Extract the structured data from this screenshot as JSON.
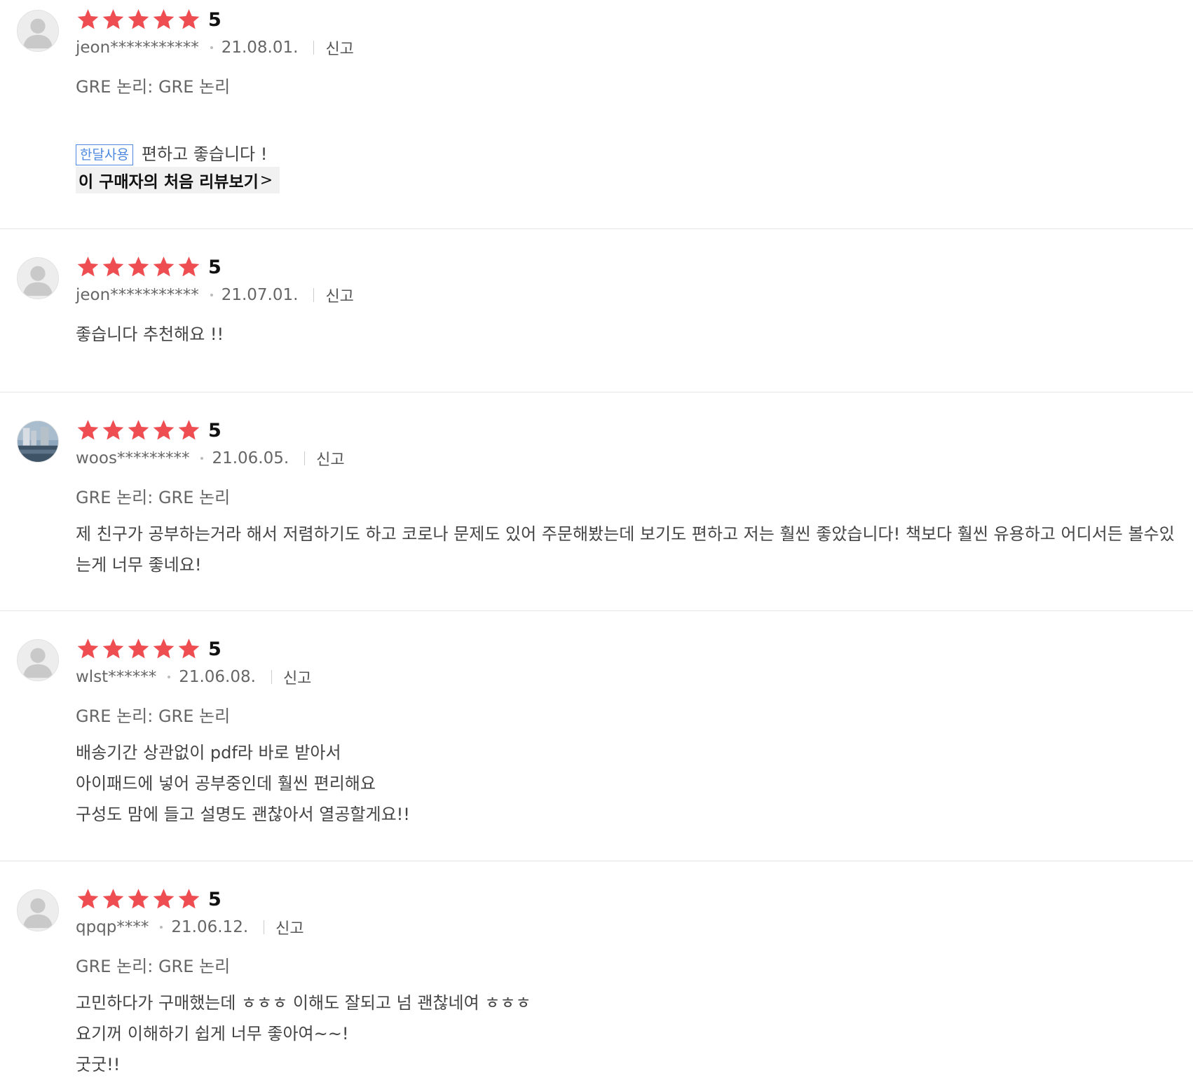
{
  "colors": {
    "star": "#ee4e52",
    "badge": "#4f8ae0",
    "divider": "#e5e5e5"
  },
  "reviews": [
    {
      "avatar": "default-avatar-icon",
      "score": "5",
      "stars": 5,
      "user": "jeon***********",
      "date": "21.08.01.",
      "report": "신고",
      "option": "GRE 논리: GRE 논리",
      "badge": "한달사용",
      "text": "편하고 좋습니다 !",
      "link": "이 구매자의 처음 리뷰보기",
      "link_chevron": ">"
    },
    {
      "avatar": "default-avatar-icon",
      "score": "5",
      "stars": 5,
      "user": "jeon***********",
      "date": "21.07.01.",
      "report": "신고",
      "text": "좋습니다 추천해요 !!"
    },
    {
      "avatar": "photo-avatar",
      "score": "5",
      "stars": 5,
      "user": "woos*********",
      "date": "21.06.05.",
      "report": "신고",
      "option": "GRE 논리: GRE 논리",
      "text": "제 친구가 공부하는거라 해서 저렴하기도 하고 코로나 문제도 있어 주문해봤는데 보기도 편하고 저는 훨씬 좋았습니다! 책보다 훨씬 유용하고 어디서든 볼수있는게 너무 좋네요!"
    },
    {
      "avatar": "default-avatar-icon",
      "score": "5",
      "stars": 5,
      "user": "wlst******",
      "date": "21.06.08.",
      "report": "신고",
      "option": "GRE 논리: GRE 논리",
      "text": "배송기간 상관없이 pdf라 바로 받아서\n아이패드에 넣어 공부중인데 훨씬 편리해요\n구성도 맘에 들고 설명도 괜찮아서 열공할게요!!"
    },
    {
      "avatar": "default-avatar-icon",
      "score": "5",
      "stars": 5,
      "user": "qpqp****",
      "date": "21.06.12.",
      "report": "신고",
      "option": "GRE 논리: GRE 논리",
      "text": "고민하다가 구매했는데 ㅎㅎㅎ 이해도 잘되고 넘 괜찮네여 ㅎㅎㅎ\n요기꺼 이해하기 쉽게 너무 좋아여~~!\n굿굿!!"
    }
  ]
}
